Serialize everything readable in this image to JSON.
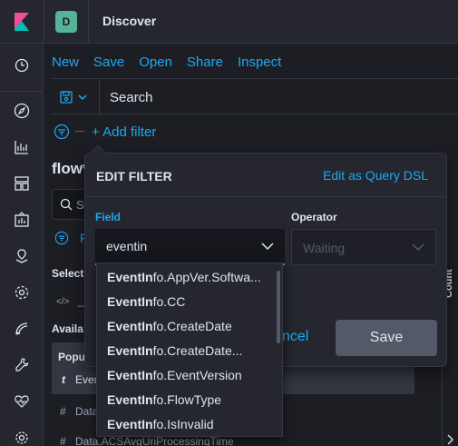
{
  "app": {
    "title": "Discover",
    "space_initial": "D"
  },
  "menu": [
    {
      "label": "New"
    },
    {
      "label": "Save"
    },
    {
      "label": "Open"
    },
    {
      "label": "Share"
    },
    {
      "label": "Inspect"
    }
  ],
  "search": {
    "placeholder": "Search"
  },
  "filters": {
    "add_label": "+ Add filter"
  },
  "sidebar": {
    "index_title": "flow*",
    "search_placeholder": "S",
    "filter_type_label": "F",
    "selected_label": "Select",
    "source_field": "_s",
    "available_label": "Availa",
    "popular_label": "Popu",
    "popular_field": {
      "type": "t",
      "name": "Even"
    },
    "fields": [
      {
        "type": "#",
        "name": "Data"
      },
      {
        "type": "#",
        "name": "Data.ACSAvgUriProcessingTime"
      }
    ],
    "count_label": "Count"
  },
  "edit_filter": {
    "title": "EDIT FILTER",
    "dsl_link": "Edit as Query DSL",
    "field_label": "Field",
    "operator_label": "Operator",
    "field_value": "eventin",
    "operator_placeholder": "Waiting",
    "cancel_label": "ncel",
    "save_label": "Save"
  },
  "field_suggestions": [
    {
      "match": "EventIn",
      "rest": "fo.AppVer.Softwa..."
    },
    {
      "match": "EventIn",
      "rest": "fo.CC"
    },
    {
      "match": "EventIn",
      "rest": "fo.CreateDate"
    },
    {
      "match": "EventIn",
      "rest": "fo.CreateDate..."
    },
    {
      "match": "EventIn",
      "rest": "fo.EventVersion"
    },
    {
      "match": "EventIn",
      "rest": "fo.FlowType"
    },
    {
      "match": "EventIn",
      "rest": "fo.IsInvalid"
    }
  ],
  "colors": {
    "accent": "#1ba9f5",
    "background": "#1d1e24",
    "panel": "#25262e",
    "border": "#343741",
    "logo_pink": "#f04e98",
    "space": "#54b399"
  }
}
